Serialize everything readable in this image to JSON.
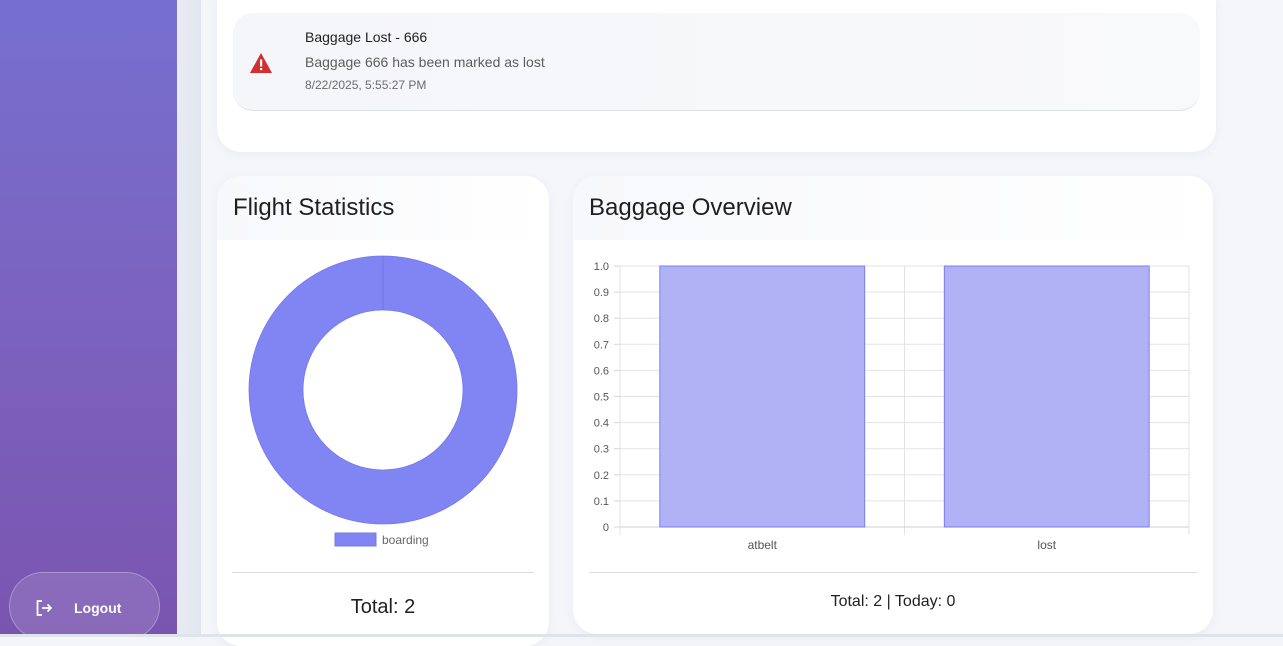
{
  "sidebar": {
    "logout_label": "Logout",
    "logout_icon": "logout-icon"
  },
  "notification": {
    "icon": "warning-icon",
    "icon_color": "#d32f2f",
    "title": "Baggage Lost - 666",
    "message": "Baggage 666 has been marked as lost",
    "timestamp": "8/22/2025, 5:55:27 PM"
  },
  "flight_stats": {
    "title": "Flight Statistics",
    "total_text": "Total: 2"
  },
  "baggage_overview": {
    "title": "Baggage Overview",
    "total_text": "Total: 2 | Today: 0"
  },
  "colors": {
    "doughnut": "#8185f3",
    "bar_fill": "#b1b2f6",
    "bar_border": "#7a7ef0"
  },
  "chart_data": [
    {
      "type": "pie",
      "variant": "doughnut",
      "categories": [
        "boarding"
      ],
      "values": [
        2
      ],
      "legend": "bottom",
      "title": ""
    },
    {
      "type": "bar",
      "categories": [
        "atbelt",
        "lost"
      ],
      "values": [
        1,
        1
      ],
      "ylim": [
        0,
        1
      ],
      "yticks": [
        "0",
        "0.1",
        "0.2",
        "0.3",
        "0.4",
        "0.5",
        "0.6",
        "0.7",
        "0.8",
        "0.9",
        "1.0"
      ],
      "grid": true,
      "title": "",
      "xlabel": "",
      "ylabel": ""
    }
  ]
}
